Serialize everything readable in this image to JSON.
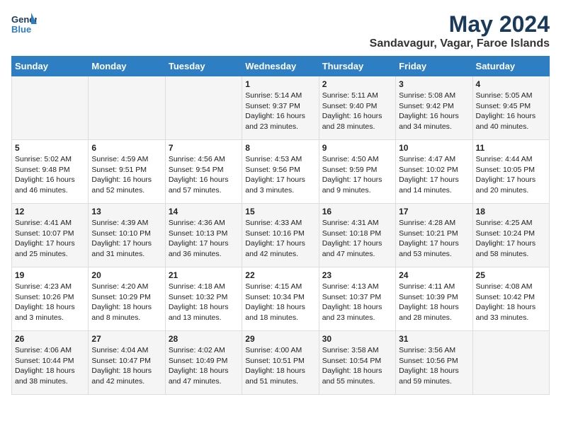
{
  "logo": {
    "line1": "General",
    "line2": "Blue"
  },
  "title": "May 2024",
  "location": "Sandavagur, Vagar, Faroe Islands",
  "days_of_week": [
    "Sunday",
    "Monday",
    "Tuesday",
    "Wednesday",
    "Thursday",
    "Friday",
    "Saturday"
  ],
  "weeks": [
    [
      {
        "day": "",
        "info": ""
      },
      {
        "day": "",
        "info": ""
      },
      {
        "day": "",
        "info": ""
      },
      {
        "day": "1",
        "info": "Sunrise: 5:14 AM\nSunset: 9:37 PM\nDaylight: 16 hours and 23 minutes."
      },
      {
        "day": "2",
        "info": "Sunrise: 5:11 AM\nSunset: 9:40 PM\nDaylight: 16 hours and 28 minutes."
      },
      {
        "day": "3",
        "info": "Sunrise: 5:08 AM\nSunset: 9:42 PM\nDaylight: 16 hours and 34 minutes."
      },
      {
        "day": "4",
        "info": "Sunrise: 5:05 AM\nSunset: 9:45 PM\nDaylight: 16 hours and 40 minutes."
      }
    ],
    [
      {
        "day": "5",
        "info": "Sunrise: 5:02 AM\nSunset: 9:48 PM\nDaylight: 16 hours and 46 minutes."
      },
      {
        "day": "6",
        "info": "Sunrise: 4:59 AM\nSunset: 9:51 PM\nDaylight: 16 hours and 52 minutes."
      },
      {
        "day": "7",
        "info": "Sunrise: 4:56 AM\nSunset: 9:54 PM\nDaylight: 16 hours and 57 minutes."
      },
      {
        "day": "8",
        "info": "Sunrise: 4:53 AM\nSunset: 9:56 PM\nDaylight: 17 hours and 3 minutes."
      },
      {
        "day": "9",
        "info": "Sunrise: 4:50 AM\nSunset: 9:59 PM\nDaylight: 17 hours and 9 minutes."
      },
      {
        "day": "10",
        "info": "Sunrise: 4:47 AM\nSunset: 10:02 PM\nDaylight: 17 hours and 14 minutes."
      },
      {
        "day": "11",
        "info": "Sunrise: 4:44 AM\nSunset: 10:05 PM\nDaylight: 17 hours and 20 minutes."
      }
    ],
    [
      {
        "day": "12",
        "info": "Sunrise: 4:41 AM\nSunset: 10:07 PM\nDaylight: 17 hours and 25 minutes."
      },
      {
        "day": "13",
        "info": "Sunrise: 4:39 AM\nSunset: 10:10 PM\nDaylight: 17 hours and 31 minutes."
      },
      {
        "day": "14",
        "info": "Sunrise: 4:36 AM\nSunset: 10:13 PM\nDaylight: 17 hours and 36 minutes."
      },
      {
        "day": "15",
        "info": "Sunrise: 4:33 AM\nSunset: 10:16 PM\nDaylight: 17 hours and 42 minutes."
      },
      {
        "day": "16",
        "info": "Sunrise: 4:31 AM\nSunset: 10:18 PM\nDaylight: 17 hours and 47 minutes."
      },
      {
        "day": "17",
        "info": "Sunrise: 4:28 AM\nSunset: 10:21 PM\nDaylight: 17 hours and 53 minutes."
      },
      {
        "day": "18",
        "info": "Sunrise: 4:25 AM\nSunset: 10:24 PM\nDaylight: 17 hours and 58 minutes."
      }
    ],
    [
      {
        "day": "19",
        "info": "Sunrise: 4:23 AM\nSunset: 10:26 PM\nDaylight: 18 hours and 3 minutes."
      },
      {
        "day": "20",
        "info": "Sunrise: 4:20 AM\nSunset: 10:29 PM\nDaylight: 18 hours and 8 minutes."
      },
      {
        "day": "21",
        "info": "Sunrise: 4:18 AM\nSunset: 10:32 PM\nDaylight: 18 hours and 13 minutes."
      },
      {
        "day": "22",
        "info": "Sunrise: 4:15 AM\nSunset: 10:34 PM\nDaylight: 18 hours and 18 minutes."
      },
      {
        "day": "23",
        "info": "Sunrise: 4:13 AM\nSunset: 10:37 PM\nDaylight: 18 hours and 23 minutes."
      },
      {
        "day": "24",
        "info": "Sunrise: 4:11 AM\nSunset: 10:39 PM\nDaylight: 18 hours and 28 minutes."
      },
      {
        "day": "25",
        "info": "Sunrise: 4:08 AM\nSunset: 10:42 PM\nDaylight: 18 hours and 33 minutes."
      }
    ],
    [
      {
        "day": "26",
        "info": "Sunrise: 4:06 AM\nSunset: 10:44 PM\nDaylight: 18 hours and 38 minutes."
      },
      {
        "day": "27",
        "info": "Sunrise: 4:04 AM\nSunset: 10:47 PM\nDaylight: 18 hours and 42 minutes."
      },
      {
        "day": "28",
        "info": "Sunrise: 4:02 AM\nSunset: 10:49 PM\nDaylight: 18 hours and 47 minutes."
      },
      {
        "day": "29",
        "info": "Sunrise: 4:00 AM\nSunset: 10:51 PM\nDaylight: 18 hours and 51 minutes."
      },
      {
        "day": "30",
        "info": "Sunrise: 3:58 AM\nSunset: 10:54 PM\nDaylight: 18 hours and 55 minutes."
      },
      {
        "day": "31",
        "info": "Sunrise: 3:56 AM\nSunset: 10:56 PM\nDaylight: 18 hours and 59 minutes."
      },
      {
        "day": "",
        "info": ""
      }
    ]
  ]
}
